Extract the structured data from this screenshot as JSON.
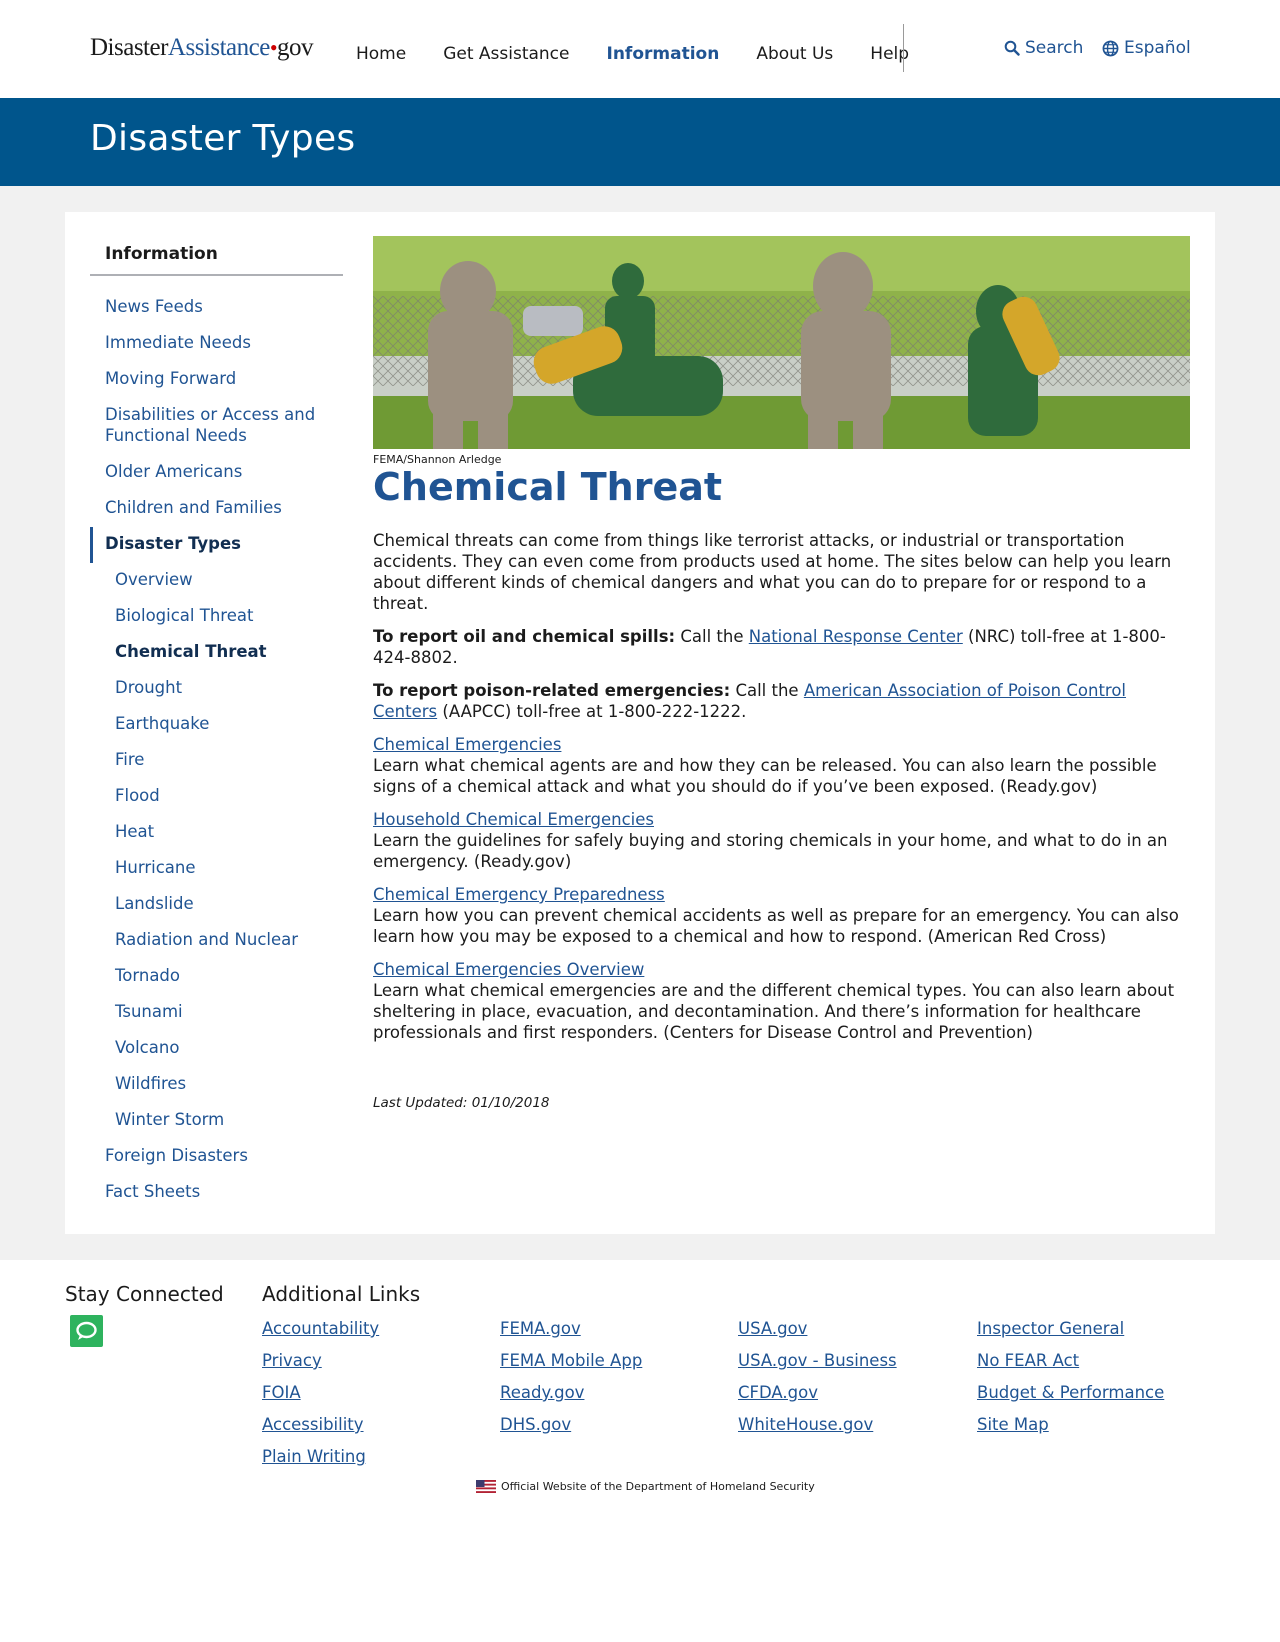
{
  "header": {
    "logo": {
      "part1": "Disaster",
      "part2": "Assistance",
      "dot": "•",
      "part3": "gov"
    },
    "nav": [
      {
        "label": "Home",
        "active": false
      },
      {
        "label": "Get Assistance",
        "active": false
      },
      {
        "label": "Information",
        "active": true
      },
      {
        "label": "About Us",
        "active": false
      },
      {
        "label": "Help",
        "active": false
      }
    ],
    "search_label": "Search",
    "language_label": "Español"
  },
  "banner": {
    "title": "Disaster Types"
  },
  "sidebar": {
    "heading": "Information",
    "items": [
      {
        "label": "News Feeds"
      },
      {
        "label": "Immediate Needs"
      },
      {
        "label": "Moving Forward"
      },
      {
        "label": "Disabilities or Access and Functional Needs"
      },
      {
        "label": "Older Americans"
      },
      {
        "label": "Children and Families"
      },
      {
        "label": "Disaster Types"
      }
    ],
    "subitems": [
      {
        "label": "Overview"
      },
      {
        "label": "Biological Threat"
      },
      {
        "label": "Chemical Threat"
      },
      {
        "label": "Drought"
      },
      {
        "label": "Earthquake"
      },
      {
        "label": "Fire"
      },
      {
        "label": "Flood"
      },
      {
        "label": "Heat"
      },
      {
        "label": "Hurricane"
      },
      {
        "label": "Landslide"
      },
      {
        "label": "Radiation and Nuclear"
      },
      {
        "label": "Tornado"
      },
      {
        "label": "Tsunami"
      },
      {
        "label": "Volcano"
      },
      {
        "label": "Wildfires"
      },
      {
        "label": "Winter Storm"
      }
    ],
    "after_items": [
      {
        "label": "Foreign Disasters"
      },
      {
        "label": "Fact Sheets"
      }
    ]
  },
  "content": {
    "image_caption": "FEMA/Shannon Arledge",
    "title": "Chemical Threat",
    "intro": "Chemical threats can come from things like terrorist attacks, or industrial or transportation accidents. They can even come from products used at home. The sites below can help you learn about different kinds of chemical dangers and what you can do to prepare for or respond to a threat.",
    "spill": {
      "lead": "To report oil and chemical spills:",
      "pre": " Call the ",
      "link": "National Response Center",
      "post": " (NRC) toll-free at 1-800-424-8802."
    },
    "poison": {
      "lead": "To report poison-related emergencies:",
      "pre": " Call the ",
      "link": "American Association of Poison Control Centers",
      "post": " (AAPCC) toll-free at 1-800-222-1222."
    },
    "resources": [
      {
        "title": "Chemical Emergencies",
        "desc": "Learn what chemical agents are and how they can be released. You can also learn the possible signs of a chemical attack and what you should do if you’ve been exposed. (Ready.gov)"
      },
      {
        "title": "Household Chemical Emergencies",
        "desc": "Learn the guidelines for safely buying and storing chemicals in your home, and what to do in an emergency. (Ready.gov)"
      },
      {
        "title": "Chemical Emergency Preparedness",
        "desc": "Learn how you can prevent chemical accidents as well as prepare for an emergency. You can also learn how you may be exposed to a chemical and how to respond. (American Red Cross)"
      },
      {
        "title": "Chemical Emergencies Overview",
        "desc": "Learn what chemical emergencies are and the different chemical types. You can also learn about sheltering in place, evacuation, and decontamination. And there’s information for healthcare professionals and first responders. (Centers for Disease Control and Prevention)"
      }
    ],
    "last_updated": "Last Updated: 01/10/2018"
  },
  "footer": {
    "stay_connected": "Stay Connected",
    "additional_links": "Additional Links",
    "columns": [
      [
        "Accountability",
        "Privacy",
        "FOIA",
        "Accessibility",
        "Plain Writing"
      ],
      [
        "FEMA.gov",
        "FEMA Mobile App",
        "Ready.gov",
        "DHS.gov"
      ],
      [
        "USA.gov",
        "USA.gov - Business",
        "CFDA.gov",
        "WhiteHouse.gov"
      ],
      [
        "Inspector General",
        "No FEAR Act",
        "Budget & Performance",
        "Site Map"
      ]
    ],
    "official": "Official Website of the Department of Homeland Security"
  },
  "colors": {
    "brand_blue": "#00558c",
    "link_blue": "#205493",
    "dark_blue": "#112e51",
    "chat_green": "#2eb35e",
    "logo_red": "#cc0000"
  },
  "icons": [
    "search-icon",
    "globe-icon",
    "chat-icon",
    "us-flag-icon"
  ]
}
